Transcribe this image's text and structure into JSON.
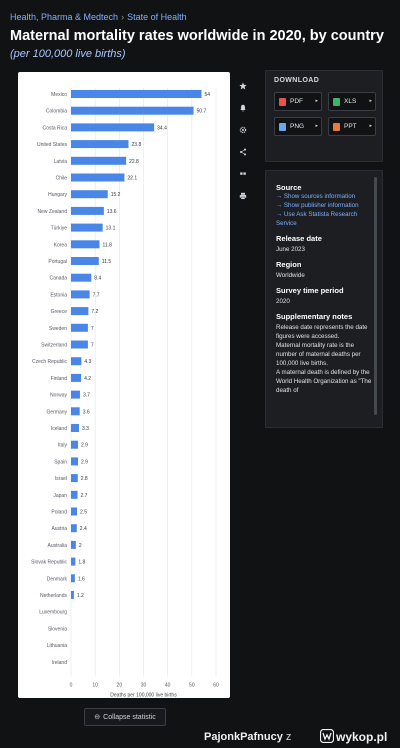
{
  "breadcrumb": {
    "a": "Health, Pharma & Medtech",
    "sep": "›",
    "b": "State of Health"
  },
  "title": "Maternal mortality rates worldwide in 2020, by country",
  "subtitle": "(per 100,000 live births)",
  "tools": [
    "star-icon",
    "bell-icon",
    "gear-icon",
    "share-icon",
    "quote-icon",
    "print-icon"
  ],
  "download": {
    "title": "DOWNLOAD",
    "buttons": [
      {
        "label": "PDF",
        "color": "#e5544b"
      },
      {
        "label": "XLS",
        "color": "#3fb26b"
      },
      {
        "label": "PNG",
        "color": "#6aa7e8"
      },
      {
        "label": "PPT",
        "color": "#e57c3b"
      }
    ]
  },
  "info": {
    "source_h": "Source",
    "link1": "→ Show sources information",
    "link2": "→ Show publisher information",
    "link3": "→ Use Ask Statista Research Service",
    "release_h": "Release date",
    "release_v": "June 2023",
    "region_h": "Region",
    "region_v": "Worldwide",
    "survey_h": "Survey time period",
    "survey_v": "2020",
    "notes_h": "Supplementary notes",
    "notes_v1": "Release date represents the date figures were accessed.",
    "notes_v2": "Maternal mortality rate is the number of maternal deaths per 100,000 live births.",
    "notes_v3": "A maternal death is defined by the World Health Organization as \"The death of"
  },
  "collapse_label": "Collapse statistic",
  "footer": {
    "user": "PajonkPafnucy",
    "z": "z",
    "site": "wykop.pl"
  },
  "chart_data": {
    "type": "bar",
    "orientation": "horizontal",
    "categories": [
      "Mexico",
      "Colombia",
      "Costa Rica",
      "United States",
      "Latvia",
      "Chile",
      "Hungary",
      "New Zealand",
      "Türkiye",
      "Korea",
      "Portugal",
      "Canada",
      "Estonia",
      "Greece",
      "Sweden",
      "Switzerland",
      "Czech Republic",
      "Finland",
      "Norway",
      "Germany",
      "Iceland",
      "Italy",
      "Spain",
      "Israel",
      "Japan",
      "Poland",
      "Austria",
      "Australia",
      "Slovak Republic",
      "Denmark",
      "Netherlands",
      "Luxembourg",
      "Slovenia",
      "Lithuania",
      "Ireland"
    ],
    "values": [
      54,
      50.7,
      34.4,
      23.8,
      22.8,
      22.1,
      15.2,
      13.6,
      13.1,
      11.8,
      11.5,
      8.4,
      7.7,
      7.2,
      7,
      7,
      4.3,
      4.2,
      3.7,
      3.6,
      3.3,
      2.9,
      2.9,
      2.8,
      2.7,
      2.5,
      2.4,
      2,
      1.8,
      1.6,
      1.2,
      0,
      0,
      0,
      0
    ],
    "value_labels": [
      "54",
      "50.7",
      "34.4",
      "23.8",
      "22.8",
      "22.1",
      "15.2",
      "13.6",
      "13.1",
      "11.8",
      "11.5",
      "8.4",
      "7.7",
      "7.2",
      "7",
      "7",
      "4.3",
      "4.2",
      "3.7",
      "3.6",
      "3.3",
      "2.9",
      "2.9",
      "2.8",
      "2.7",
      "2.5",
      "2.4",
      "2",
      "1.8",
      "1.6",
      "1.2",
      "",
      "",
      "",
      ""
    ],
    "xlim": [
      0,
      60
    ],
    "xticks": [
      "0",
      "10",
      "20",
      "30",
      "40",
      "50",
      "60"
    ],
    "xlabel": "Deaths per 100,000 live births",
    "bar_color": "#4a86e8",
    "grid": true
  }
}
